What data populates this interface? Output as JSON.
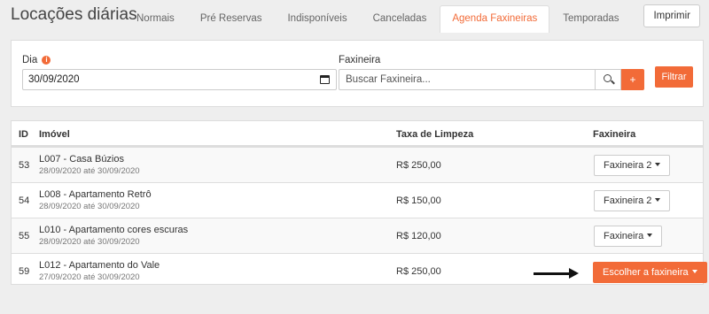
{
  "page": {
    "title": "Locações diárias"
  },
  "tabs": [
    {
      "label": "Normais",
      "active": false
    },
    {
      "label": "Pré Reservas",
      "active": false
    },
    {
      "label": "Indisponíveis",
      "active": false
    },
    {
      "label": "Canceladas",
      "active": false
    },
    {
      "label": "Agenda Faxineiras",
      "active": true
    },
    {
      "label": "Temporadas",
      "active": false
    }
  ],
  "header": {
    "print_label": "Imprimir"
  },
  "filters": {
    "day_label": "Dia",
    "day_info_icon": "info-icon",
    "day_value": "30/09/2020",
    "cleaner_label": "Faxineira",
    "cleaner_placeholder": "Buscar Faxineira...",
    "add_label": "+",
    "filter_label": "Filtrar"
  },
  "table": {
    "columns": [
      "ID",
      "Imóvel",
      "Taxa de Limpeza",
      "Faxineira"
    ],
    "rows": [
      {
        "id": "53",
        "name": "L007 - Casa Búzios",
        "dates": "28/09/2020 até 30/09/2020",
        "fee": "R$ 250,00",
        "cleaner": "Faxineira 2",
        "primary": false
      },
      {
        "id": "54",
        "name": "L008 - Apartamento Retrô",
        "dates": "28/09/2020 até 30/09/2020",
        "fee": "R$ 150,00",
        "cleaner": "Faxineira 2",
        "primary": false
      },
      {
        "id": "55",
        "name": "L010 - Apartamento cores escuras",
        "dates": "28/09/2020 até 30/09/2020",
        "fee": "R$ 120,00",
        "cleaner": "Faxineira",
        "primary": false
      },
      {
        "id": "59",
        "name": "L012 - Apartamento do Vale",
        "dates": "27/09/2020 até 30/09/2020",
        "fee": "R$ 250,00",
        "cleaner": "Escolher a faxineira",
        "primary": true
      }
    ]
  },
  "colors": {
    "accent": "#f26b38",
    "background": "#eeeeee",
    "border": "#dddddd",
    "stripe": "#f9f9f9"
  }
}
